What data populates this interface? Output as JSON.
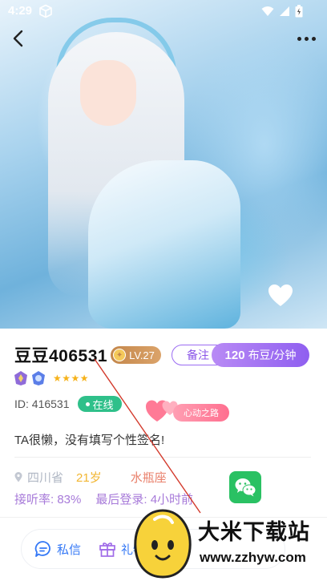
{
  "status_bar": {
    "time": "4:29"
  },
  "profile": {
    "username": "豆豆406531",
    "level": "LV.27",
    "remark_label": "备注",
    "price_amount": "120",
    "price_unit": "布豆/分钟",
    "id_text": "ID: 416531",
    "online_label": "在线",
    "heartbeat_label": "心动之路",
    "bio": "TA很懒，没有填写个性签名!",
    "province": "四川省",
    "age": "21岁",
    "zodiac": "水瓶座",
    "answer_rate": "接听率: 83%",
    "last_login": "最后登录: 4小时前",
    "stars": "★★★★",
    "star_rating": 4
  },
  "actions": {
    "message_label": "私信",
    "gift_label": "礼物"
  },
  "watermark": {
    "title": "大米下载站",
    "url": "www.zzhyw.com"
  },
  "colors": {
    "accent_purple": "#8f5ff0",
    "online_green": "#2fc08a",
    "level_gold": "#c4874b",
    "action_blue": "#3478f6",
    "wechat_green": "#2ac163"
  },
  "icons": [
    "back-arrow-icon",
    "more-dots-icon",
    "heart-icon",
    "cube-icon",
    "wifi-icon",
    "signal-icon",
    "battery-icon",
    "coin-icon",
    "medal-icon",
    "location-pin-icon",
    "wechat-icon",
    "chat-icon",
    "gift-icon"
  ]
}
